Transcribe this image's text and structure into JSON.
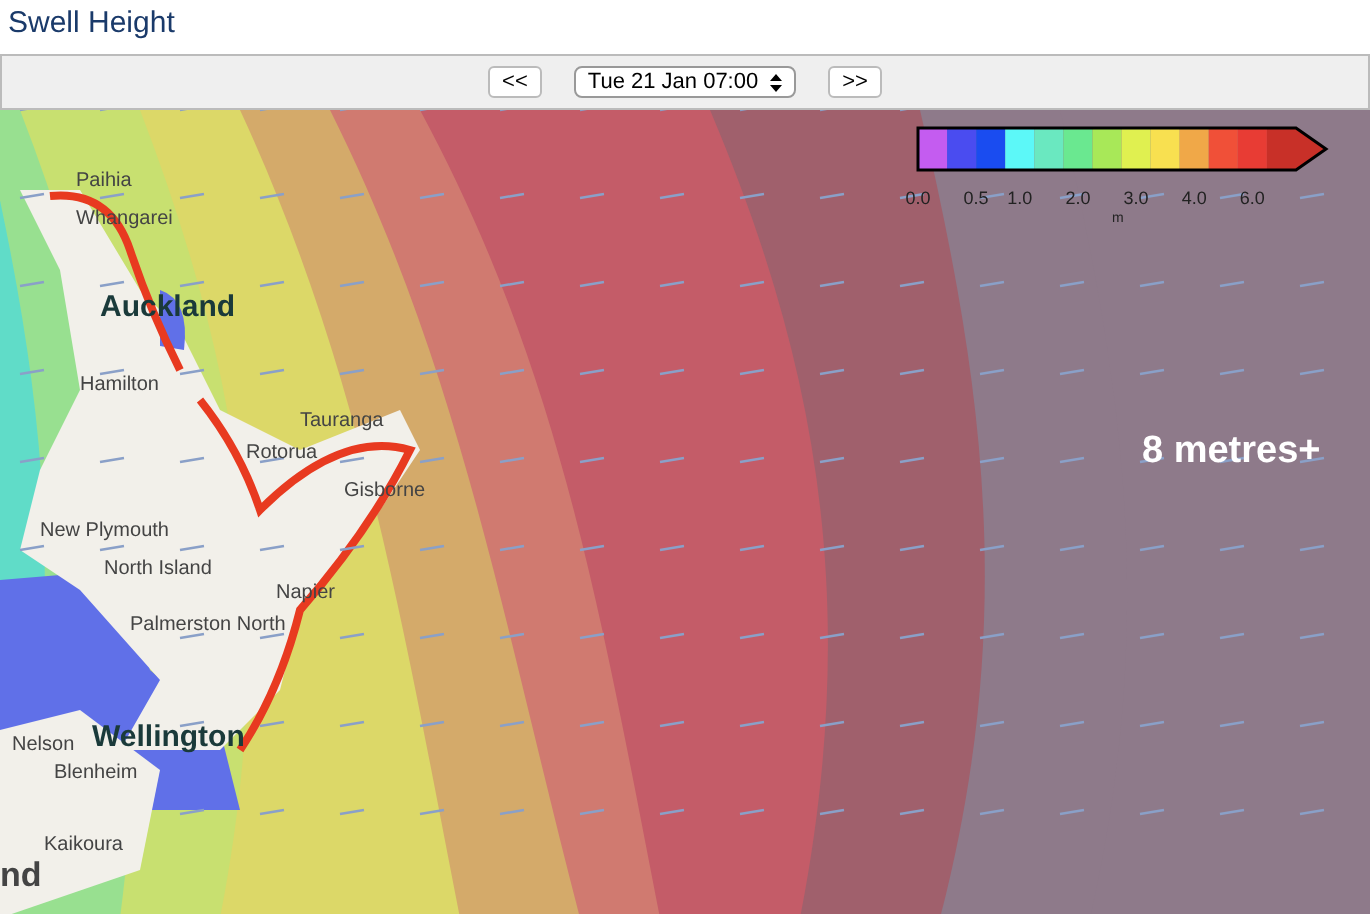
{
  "title": "Swell Height",
  "toolbar": {
    "prev": "<<",
    "time": "Tue 21 Jan 07:00",
    "next": ">>"
  },
  "legend": {
    "bins": [
      {
        "color": "#c45cf0"
      },
      {
        "color": "#4a4cf0"
      },
      {
        "color": "#1a4cf0"
      },
      {
        "color": "#5cf8f8"
      },
      {
        "color": "#6ae8c0"
      },
      {
        "color": "#6ae890"
      },
      {
        "color": "#a8e858"
      },
      {
        "color": "#e0f050"
      },
      {
        "color": "#f8e050"
      },
      {
        "color": "#f0a848"
      },
      {
        "color": "#f05038"
      },
      {
        "color": "#e83c34"
      },
      {
        "color": "#c83028"
      }
    ],
    "ticks": [
      "0.0",
      "0.5",
      "1.0",
      "2.0",
      "3.0",
      "4.0",
      "6.0"
    ],
    "unit": "m"
  },
  "annotation": "8 metres+",
  "places": [
    {
      "name": "Paihia",
      "kind": "town"
    },
    {
      "name": "Whangarei",
      "kind": "town"
    },
    {
      "name": "Auckland",
      "kind": "city"
    },
    {
      "name": "Hamilton",
      "kind": "town"
    },
    {
      "name": "Tauranga",
      "kind": "town"
    },
    {
      "name": "Rotorua",
      "kind": "town"
    },
    {
      "name": "Gisborne",
      "kind": "town"
    },
    {
      "name": "New Plymouth",
      "kind": "town"
    },
    {
      "name": "North Island",
      "kind": "region"
    },
    {
      "name": "Napier",
      "kind": "town"
    },
    {
      "name": "Palmerston North",
      "kind": "town"
    },
    {
      "name": "Nelson",
      "kind": "town"
    },
    {
      "name": "Wellington",
      "kind": "city"
    },
    {
      "name": "Blenheim",
      "kind": "town"
    },
    {
      "name": "Kaikoura",
      "kind": "town"
    },
    {
      "name": "nd",
      "kind": "island"
    }
  ]
}
